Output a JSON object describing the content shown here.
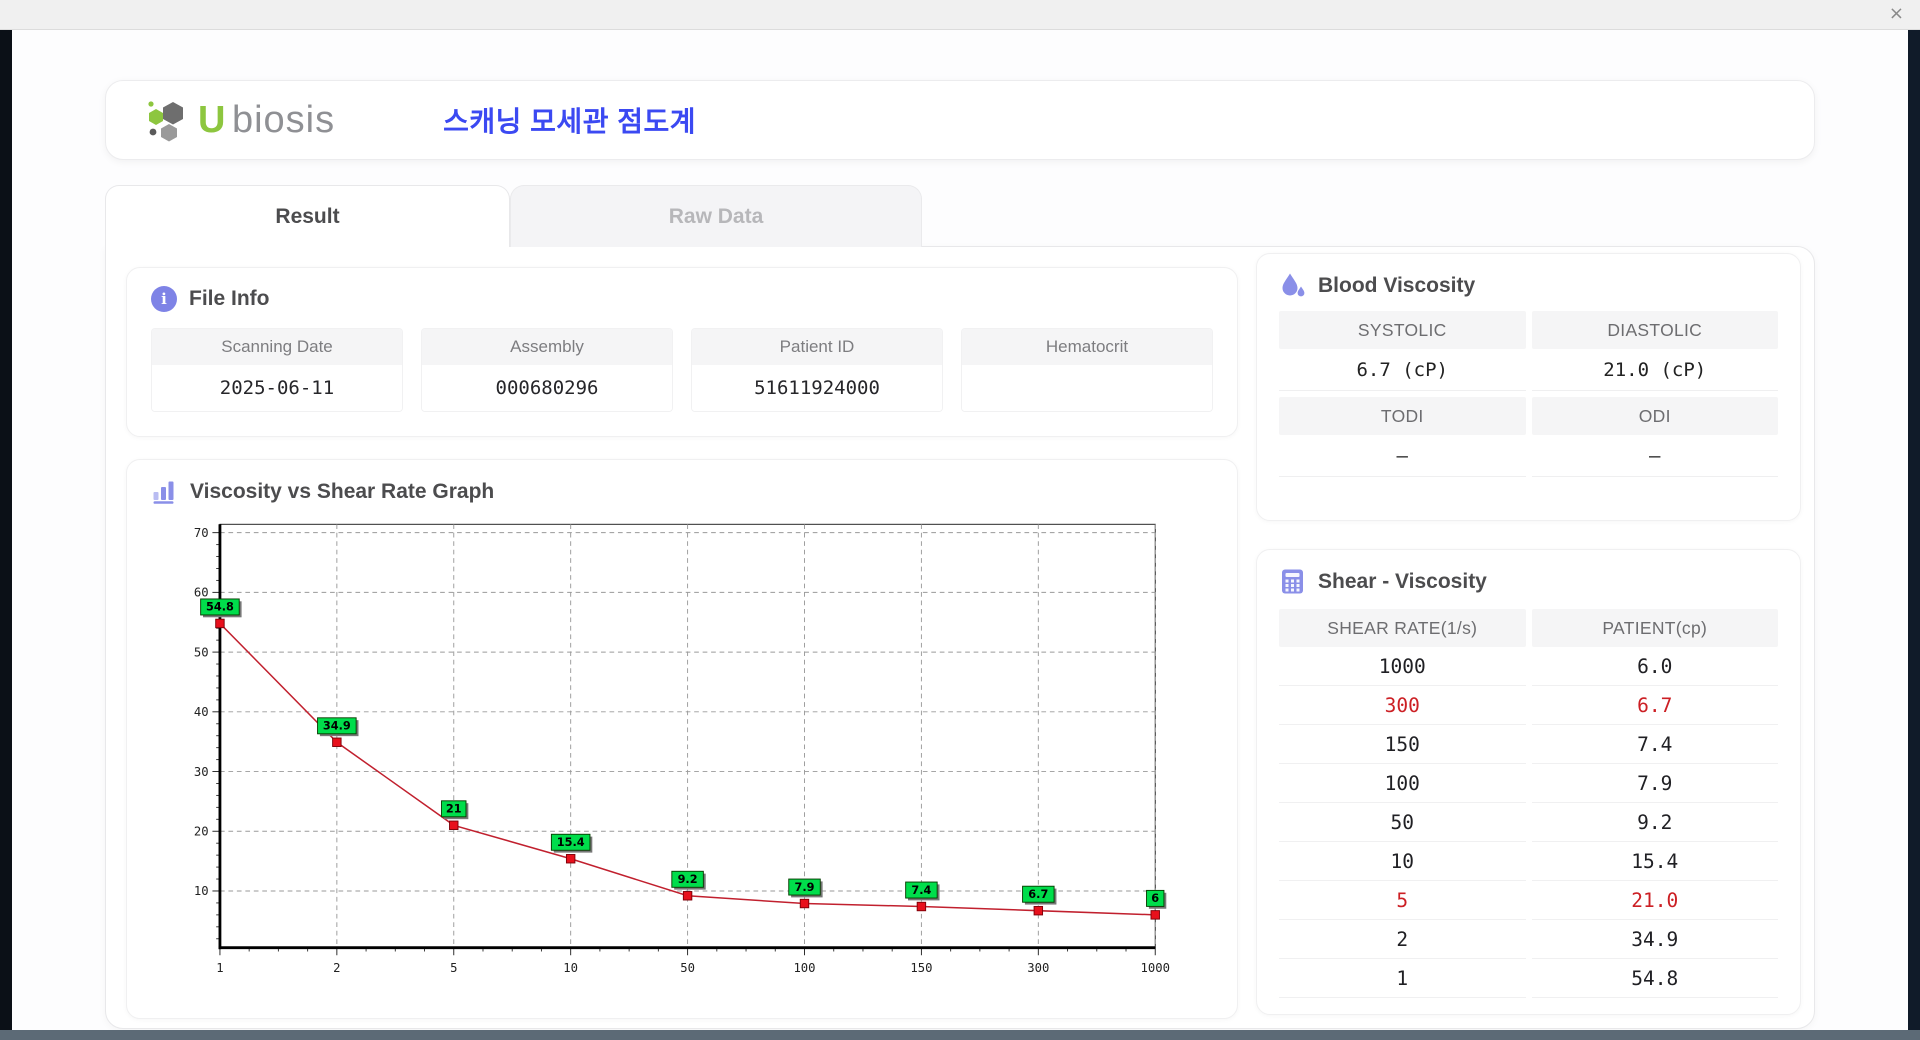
{
  "window": {
    "close_label": "×"
  },
  "header": {
    "brand_u": "U",
    "brand_rest": "biosis",
    "app_title": "스캐닝 모세관 점도계"
  },
  "tabs": [
    {
      "label": "Result",
      "active": true
    },
    {
      "label": "Raw Data",
      "active": false
    }
  ],
  "file_info": {
    "title": "File Info",
    "fields": [
      {
        "label": "Scanning Date",
        "value": "2025-06-11"
      },
      {
        "label": "Assembly",
        "value": "000680296"
      },
      {
        "label": "Patient ID",
        "value": "51611924000"
      },
      {
        "label": "Hematocrit",
        "value": ""
      }
    ]
  },
  "graph": {
    "title": "Viscosity vs Shear Rate Graph"
  },
  "blood_viscosity": {
    "title": "Blood Viscosity",
    "groups": [
      {
        "headers": [
          "SYSTOLIC",
          "DIASTOLIC"
        ],
        "values": [
          "6.7 (cP)",
          "21.0 (cP)"
        ]
      },
      {
        "headers": [
          "TODI",
          "ODI"
        ],
        "values": [
          "–",
          "–"
        ]
      }
    ]
  },
  "shear_viscosity": {
    "title": "Shear - Viscosity",
    "columns": [
      "SHEAR RATE(1/s)",
      "PATIENT(cp)"
    ],
    "rows": [
      {
        "shear_rate": "1000",
        "patient": "6.0",
        "highlight": false
      },
      {
        "shear_rate": "300",
        "patient": "6.7",
        "highlight": true
      },
      {
        "shear_rate": "150",
        "patient": "7.4",
        "highlight": false
      },
      {
        "shear_rate": "100",
        "patient": "7.9",
        "highlight": false
      },
      {
        "shear_rate": "50",
        "patient": "9.2",
        "highlight": false
      },
      {
        "shear_rate": "10",
        "patient": "15.4",
        "highlight": false
      },
      {
        "shear_rate": "5",
        "patient": "21.0",
        "highlight": true
      },
      {
        "shear_rate": "2",
        "patient": "34.9",
        "highlight": false
      },
      {
        "shear_rate": "1",
        "patient": "54.8",
        "highlight": false
      }
    ]
  },
  "chart_data": {
    "type": "line",
    "x_scale": "categorical",
    "categories": [
      "1",
      "2",
      "5",
      "10",
      "50",
      "100",
      "150",
      "300",
      "1000"
    ],
    "values": [
      54.8,
      34.9,
      21,
      15.4,
      9.2,
      7.9,
      7.4,
      6.7,
      6
    ],
    "point_labels": [
      "54.8",
      "34.9",
      "21",
      "15.4",
      "9.2",
      "7.9",
      "7.4",
      "6.7",
      "6"
    ],
    "title": "Viscosity vs Shear Rate Graph",
    "xlabel": "",
    "ylabel": "",
    "ylim": [
      0,
      70
    ],
    "yticks": [
      10,
      20,
      30,
      40,
      50,
      60,
      70
    ],
    "grid": true,
    "legend": false,
    "line_color": "#c1202e",
    "marker_color": "#e8101c",
    "marker_border": "#7e0008",
    "point_label_bg": "#00dd4b",
    "grid_color": "#9a9a9a"
  },
  "colors": {
    "accent_indigo": "#7e83e6",
    "title_blue": "#3b49f2",
    "brand_green": "#8dc63f",
    "highlight_red": "#cc1f24"
  }
}
